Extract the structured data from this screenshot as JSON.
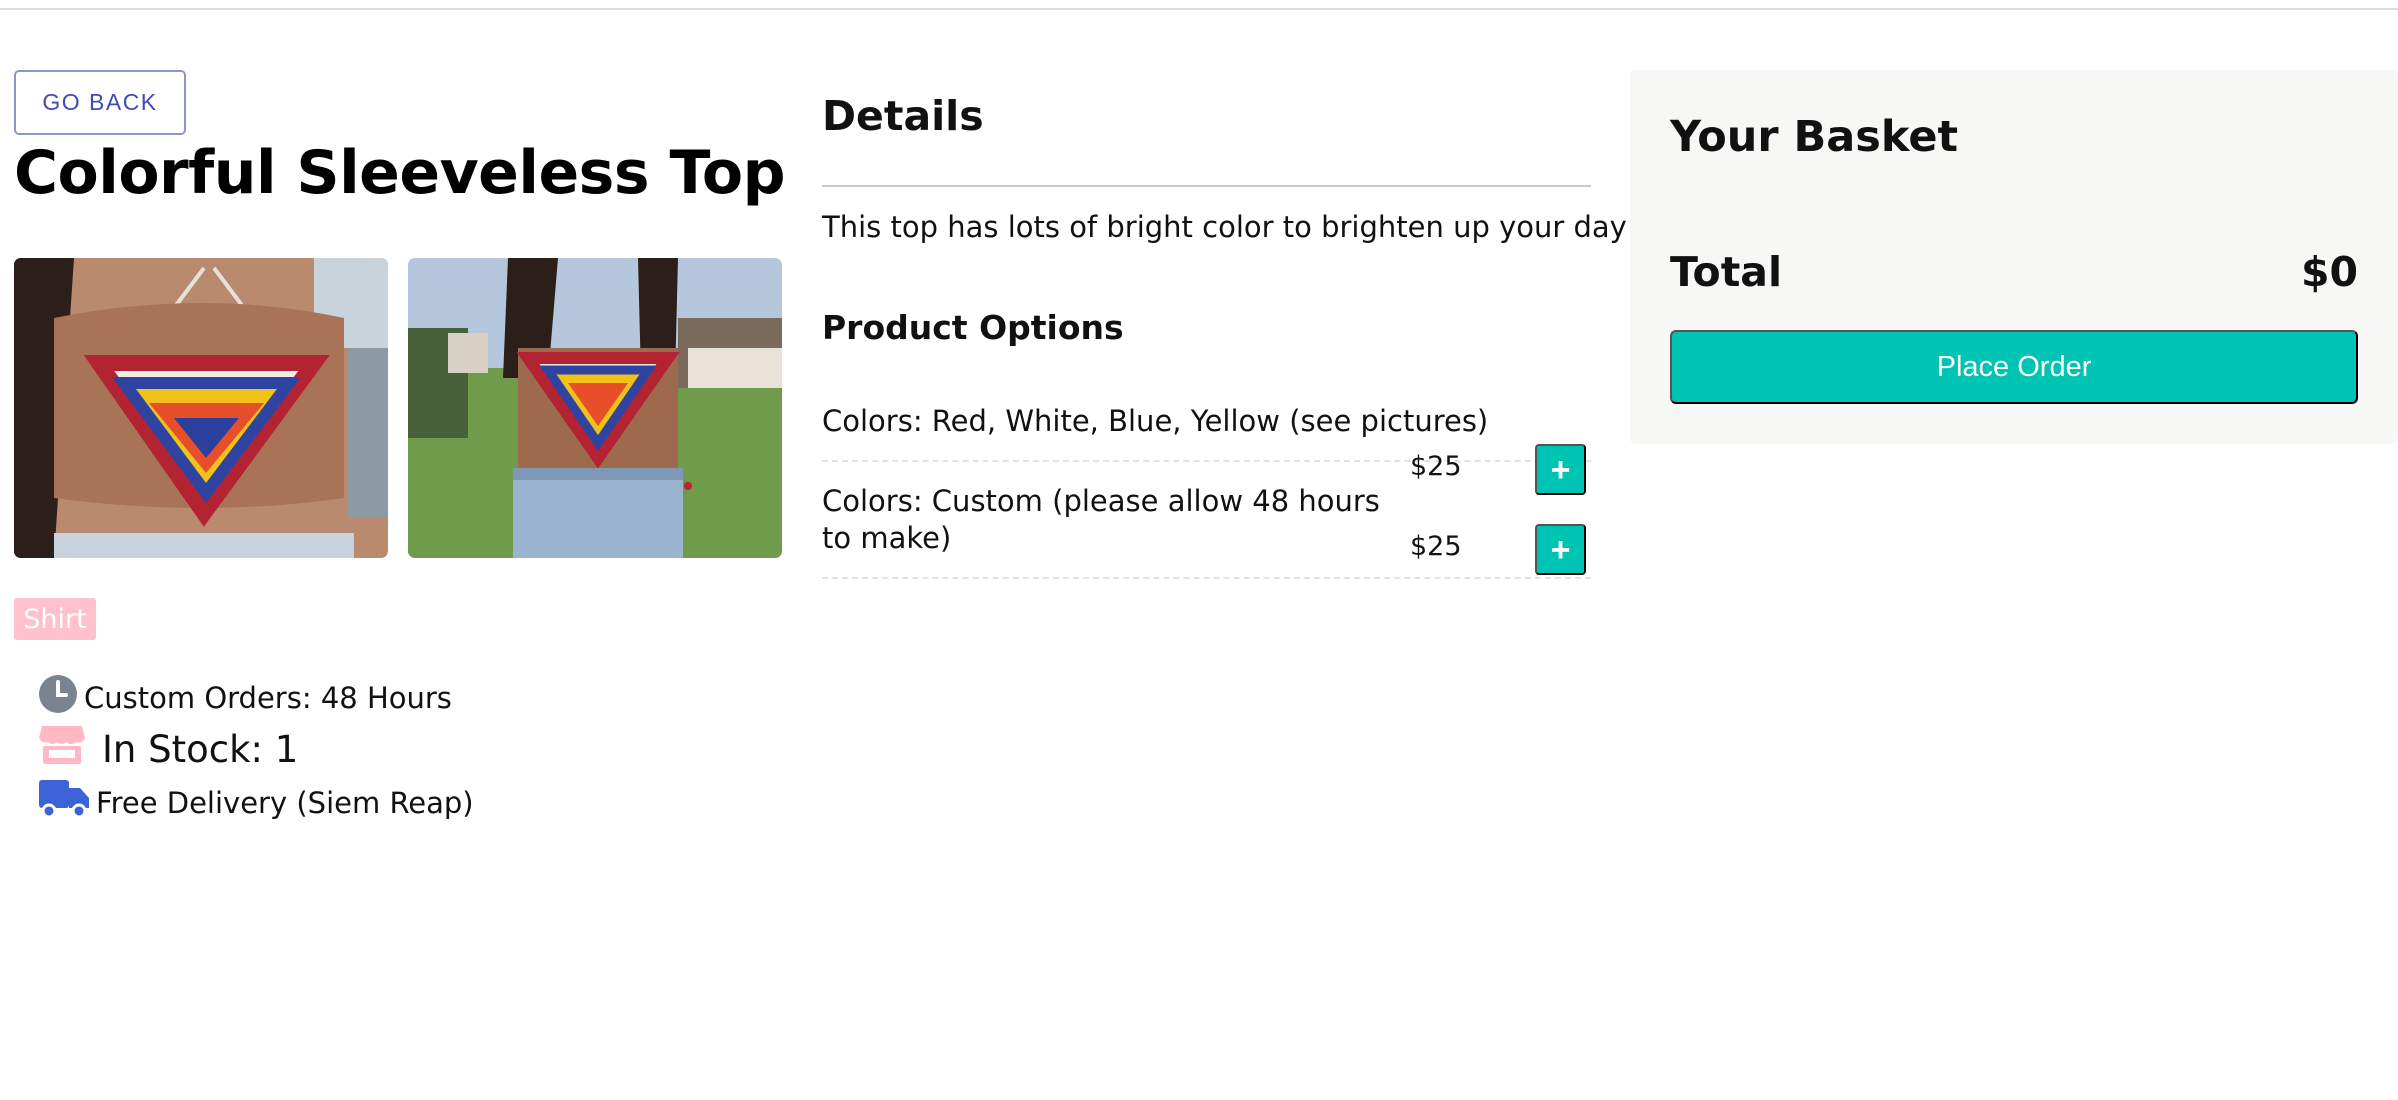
{
  "nav": {
    "back_label": "GO BACK"
  },
  "product": {
    "title": "Colorful Sleeveless Top",
    "tag": "Shirt",
    "info": [
      {
        "icon": "clock-icon",
        "text": "Custom Orders: 48 Hours"
      },
      {
        "icon": "store-icon",
        "text": "In Stock: 1"
      },
      {
        "icon": "truck-icon",
        "text": "Free Delivery (Siem Reap)"
      }
    ]
  },
  "details": {
    "title": "Details",
    "description": "This top has lots of bright color to brighten up your day",
    "options_title": "Product Options",
    "options": [
      {
        "label": "Colors: Red, White, Blue, Yellow (see pictures)",
        "price": "$25",
        "add_label": "+"
      },
      {
        "label": "Colors: Custom (please allow 48 hours to make)",
        "price": "$25",
        "add_label": "+"
      }
    ]
  },
  "basket": {
    "title": "Your Basket",
    "total_label": "Total",
    "total_value": "$0",
    "order_label": "Place Order"
  },
  "colors": {
    "accent": "#00c4b3",
    "back_button_text": "#3f4cb5",
    "tag_bg": "#ffc2cd",
    "basket_bg": "#f7f8f5",
    "clock_icon": "#7a8491",
    "store_icon": "#ffb8c4",
    "truck_icon": "#3c63d6"
  }
}
